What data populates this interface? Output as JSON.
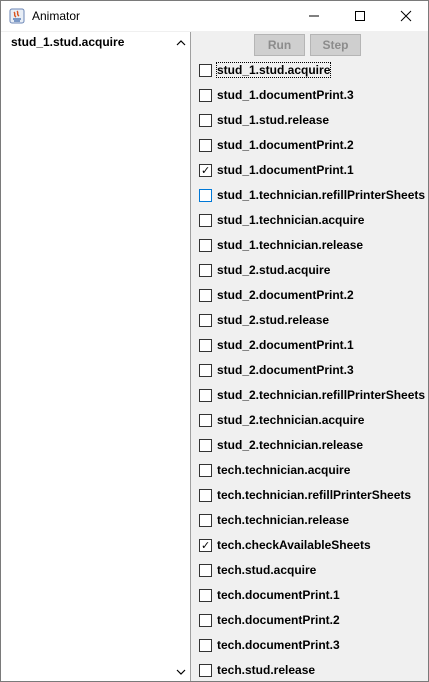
{
  "window": {
    "title": "Animator"
  },
  "left_list": {
    "items": [
      "stud_1.stud.acquire"
    ]
  },
  "buttons": {
    "run": "Run",
    "step": "Step"
  },
  "actions": [
    {
      "label": "stud_1.stud.acquire",
      "checked": false
    },
    {
      "label": "stud_1.documentPrint.3",
      "checked": false
    },
    {
      "label": "stud_1.stud.release",
      "checked": false
    },
    {
      "label": "stud_1.documentPrint.2",
      "checked": false
    },
    {
      "label": "stud_1.documentPrint.1",
      "checked": true
    },
    {
      "label": "stud_1.technician.refillPrinterSheets",
      "checked": false
    },
    {
      "label": "stud_1.technician.acquire",
      "checked": false
    },
    {
      "label": "stud_1.technician.release",
      "checked": false
    },
    {
      "label": "stud_2.stud.acquire",
      "checked": false
    },
    {
      "label": "stud_2.documentPrint.2",
      "checked": false
    },
    {
      "label": "stud_2.stud.release",
      "checked": false
    },
    {
      "label": "stud_2.documentPrint.1",
      "checked": false
    },
    {
      "label": "stud_2.documentPrint.3",
      "checked": false
    },
    {
      "label": "stud_2.technician.refillPrinterSheets",
      "checked": false
    },
    {
      "label": "stud_2.technician.acquire",
      "checked": false
    },
    {
      "label": "stud_2.technician.release",
      "checked": false
    },
    {
      "label": "tech.technician.acquire",
      "checked": false
    },
    {
      "label": "tech.technician.refillPrinterSheets",
      "checked": false
    },
    {
      "label": "tech.technician.release",
      "checked": false
    },
    {
      "label": "tech.checkAvailableSheets",
      "checked": true
    },
    {
      "label": "tech.stud.acquire",
      "checked": false
    },
    {
      "label": "tech.documentPrint.1",
      "checked": false
    },
    {
      "label": "tech.documentPrint.2",
      "checked": false
    },
    {
      "label": "tech.documentPrint.3",
      "checked": false
    },
    {
      "label": "tech.stud.release",
      "checked": false
    }
  ]
}
